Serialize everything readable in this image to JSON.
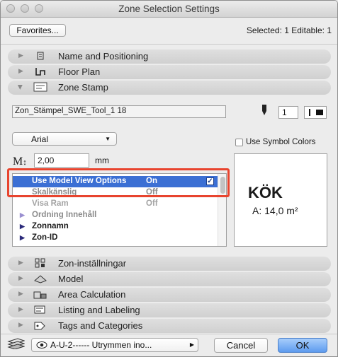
{
  "window": {
    "title": "Zone Selection Settings"
  },
  "toolbar": {
    "favorites_label": "Favorites...",
    "selection_status": "Selected: 1 Editable: 1"
  },
  "sections": [
    {
      "label": "Name and Positioning",
      "icon": "name-positioning-icon",
      "expanded": false
    },
    {
      "label": "Floor Plan",
      "icon": "floor-plan-icon",
      "expanded": false
    },
    {
      "label": "Zone Stamp",
      "icon": "zone-stamp-icon",
      "expanded": true
    }
  ],
  "zone_stamp": {
    "library_part": "Zon_Stämpel_SWE_Tool_1 18",
    "pen_number": "1",
    "font": "Arial",
    "use_symbol_colors_label": "Use Symbol Colors",
    "use_symbol_colors_checked": false,
    "text_size": "2,00",
    "text_size_unit": "mm",
    "params": [
      {
        "name": "Use Model View Options",
        "value": "On",
        "state": "selected",
        "checked": true
      },
      {
        "name": "Skalkänslig",
        "value": "Off",
        "state": "muted",
        "expand": false
      },
      {
        "name": "Visa Ram",
        "value": "Off",
        "state": "dim",
        "expand": false
      },
      {
        "name": "Ordning Innehåll",
        "value": "",
        "state": "muted",
        "expand": true
      },
      {
        "name": "Zonnamn",
        "value": "",
        "state": "dark",
        "expand": true
      },
      {
        "name": "Zon-ID",
        "value": "",
        "state": "dark",
        "expand": true
      }
    ],
    "preview": {
      "name": "KÖK",
      "area": "A: 14,0 m²"
    }
  },
  "more_sections": [
    {
      "label": "Zon-inställningar",
      "icon": "zone-settings-icon"
    },
    {
      "label": "Model",
      "icon": "model-icon"
    },
    {
      "label": "Area Calculation",
      "icon": "area-calculation-icon"
    },
    {
      "label": "Listing and Labeling",
      "icon": "listing-labeling-icon"
    },
    {
      "label": "Tags and Categories",
      "icon": "tags-categories-icon"
    }
  ],
  "footer": {
    "layer": "A-U-2------ Utrymmen ino...",
    "cancel_label": "Cancel",
    "ok_label": "OK"
  },
  "colors": {
    "selection": "#3b6fd4",
    "highlight_box": "#e8442e",
    "ok_button": "#6ea5ef"
  }
}
